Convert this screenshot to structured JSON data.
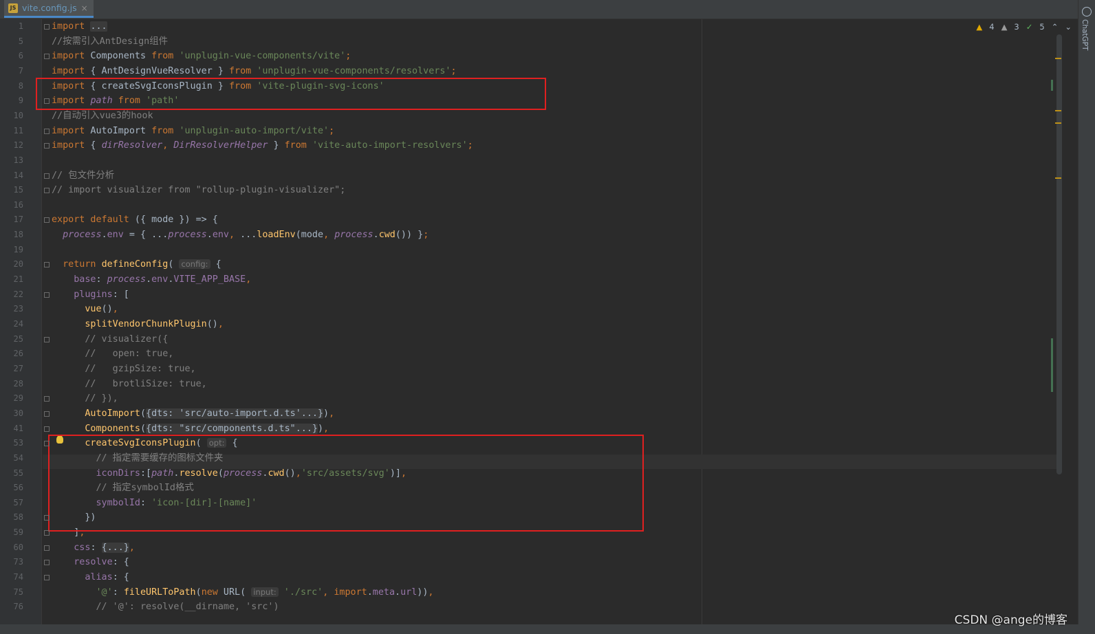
{
  "tab": {
    "label": "vite.config.js",
    "icon": "js-file-icon",
    "close": "×"
  },
  "right_panel": {
    "label": "ChatGPT",
    "icon": "openai-icon"
  },
  "inspection": {
    "warnings": "4",
    "weak_warnings": "3",
    "ok": "5",
    "prev": "^",
    "next": "v"
  },
  "line_numbers": [
    "1",
    "5",
    "6",
    "7",
    "8",
    "9",
    "10",
    "11",
    "12",
    "13",
    "14",
    "15",
    "16",
    "17",
    "18",
    "19",
    "20",
    "21",
    "22",
    "23",
    "24",
    "25",
    "26",
    "27",
    "28",
    "29",
    "30",
    "41",
    "53",
    "54",
    "55",
    "56",
    "57",
    "58",
    "59",
    "60",
    "73",
    "74",
    "75",
    "76"
  ],
  "code": [
    [
      {
        "c": "kw",
        "t": "import"
      },
      {
        "c": "",
        "t": " "
      },
      {
        "c": "fold-text",
        "t": "..."
      }
    ],
    [
      {
        "c": "cm",
        "t": "//按需引入AntDesign组件"
      }
    ],
    [
      {
        "c": "kw",
        "t": "import"
      },
      {
        "c": "",
        "t": " Components "
      },
      {
        "c": "kw",
        "t": "from"
      },
      {
        "c": "",
        "t": " "
      },
      {
        "c": "str",
        "t": "'unplugin-vue-components/vite'"
      },
      {
        "c": "kw",
        "t": ";"
      }
    ],
    [
      {
        "c": "kw",
        "t": "import"
      },
      {
        "c": "",
        "t": " { AntDesignVueResolver } "
      },
      {
        "c": "kw",
        "t": "from"
      },
      {
        "c": "",
        "t": " "
      },
      {
        "c": "str",
        "t": "'unplugin-vue-components/resolvers'"
      },
      {
        "c": "kw",
        "t": ";"
      }
    ],
    [
      {
        "c": "kw",
        "t": "import"
      },
      {
        "c": "",
        "t": " { createSvgIconsPlugin } "
      },
      {
        "c": "kw",
        "t": "from"
      },
      {
        "c": "",
        "t": " "
      },
      {
        "c": "str",
        "t": "'vite-plugin-svg-icons'"
      }
    ],
    [
      {
        "c": "kw",
        "t": "import"
      },
      {
        "c": "",
        "t": " "
      },
      {
        "c": "prop it",
        "t": "path"
      },
      {
        "c": "",
        "t": " "
      },
      {
        "c": "kw",
        "t": "from"
      },
      {
        "c": "",
        "t": " "
      },
      {
        "c": "str",
        "t": "'path'"
      }
    ],
    [
      {
        "c": "cm",
        "t": "//自动引入vue3的hook"
      }
    ],
    [
      {
        "c": "kw",
        "t": "import"
      },
      {
        "c": "",
        "t": " AutoImport "
      },
      {
        "c": "kw",
        "t": "from"
      },
      {
        "c": "",
        "t": " "
      },
      {
        "c": "str",
        "t": "'unplugin-auto-import/vite'"
      },
      {
        "c": "kw",
        "t": ";"
      }
    ],
    [
      {
        "c": "kw",
        "t": "import"
      },
      {
        "c": "",
        "t": " { "
      },
      {
        "c": "prop it",
        "t": "dirResolver"
      },
      {
        "c": "kw",
        "t": ","
      },
      {
        "c": "",
        "t": " "
      },
      {
        "c": "prop it",
        "t": "DirResolverHelper"
      },
      {
        "c": "",
        "t": " } "
      },
      {
        "c": "kw",
        "t": "from"
      },
      {
        "c": "",
        "t": " "
      },
      {
        "c": "str",
        "t": "'vite-auto-import-resolvers'"
      },
      {
        "c": "kw",
        "t": ";"
      }
    ],
    [],
    [
      {
        "c": "cm",
        "t": "// 包文件分析"
      }
    ],
    [
      {
        "c": "cm",
        "t": "// import visualizer from \"rollup-plugin-visualizer\";"
      }
    ],
    [],
    [
      {
        "c": "kw",
        "t": "export default"
      },
      {
        "c": "",
        "t": " ({ mode }) => {"
      }
    ],
    [
      {
        "c": "",
        "t": "  "
      },
      {
        "c": "prop it",
        "t": "process"
      },
      {
        "c": "",
        "t": "."
      },
      {
        "c": "prop",
        "t": "env"
      },
      {
        "c": "",
        "t": " = { ..."
      },
      {
        "c": "prop it",
        "t": "process"
      },
      {
        "c": "",
        "t": "."
      },
      {
        "c": "prop",
        "t": "env"
      },
      {
        "c": "kw",
        "t": ","
      },
      {
        "c": "",
        "t": " ..."
      },
      {
        "c": "fn",
        "t": "loadEnv"
      },
      {
        "c": "",
        "t": "(mode"
      },
      {
        "c": "kw",
        "t": ","
      },
      {
        "c": "",
        "t": " "
      },
      {
        "c": "prop it",
        "t": "process"
      },
      {
        "c": "",
        "t": "."
      },
      {
        "c": "fn",
        "t": "cwd"
      },
      {
        "c": "",
        "t": "()) }"
      },
      {
        "c": "kw",
        "t": ";"
      }
    ],
    [],
    [
      {
        "c": "",
        "t": "  "
      },
      {
        "c": "kw",
        "t": "return"
      },
      {
        "c": "",
        "t": " "
      },
      {
        "c": "fn",
        "t": "defineConfig"
      },
      {
        "c": "",
        "t": "( "
      },
      {
        "c": "hint",
        "t": "config:"
      },
      {
        "c": "",
        "t": " {"
      }
    ],
    [
      {
        "c": "",
        "t": "    "
      },
      {
        "c": "prop",
        "t": "base"
      },
      {
        "c": "",
        "t": ": "
      },
      {
        "c": "prop it",
        "t": "process"
      },
      {
        "c": "",
        "t": "."
      },
      {
        "c": "prop",
        "t": "env"
      },
      {
        "c": "",
        "t": "."
      },
      {
        "c": "prop",
        "t": "VITE_APP_BASE"
      },
      {
        "c": "kw",
        "t": ","
      }
    ],
    [
      {
        "c": "",
        "t": "    "
      },
      {
        "c": "prop",
        "t": "plugins"
      },
      {
        "c": "",
        "t": ": ["
      }
    ],
    [
      {
        "c": "",
        "t": "      "
      },
      {
        "c": "fn",
        "t": "vue"
      },
      {
        "c": "",
        "t": "()"
      },
      {
        "c": "kw",
        "t": ","
      }
    ],
    [
      {
        "c": "",
        "t": "      "
      },
      {
        "c": "fn",
        "t": "splitVendorChunkPlugin"
      },
      {
        "c": "",
        "t": "()"
      },
      {
        "c": "kw",
        "t": ","
      }
    ],
    [
      {
        "c": "",
        "t": "      "
      },
      {
        "c": "cm",
        "t": "// visualizer({"
      }
    ],
    [
      {
        "c": "",
        "t": "      "
      },
      {
        "c": "cm",
        "t": "//   open: true,"
      }
    ],
    [
      {
        "c": "",
        "t": "      "
      },
      {
        "c": "cm",
        "t": "//   gzipSize: true,"
      }
    ],
    [
      {
        "c": "",
        "t": "      "
      },
      {
        "c": "cm",
        "t": "//   brotliSize: true,"
      }
    ],
    [
      {
        "c": "",
        "t": "      "
      },
      {
        "c": "cm",
        "t": "// }),"
      }
    ],
    [
      {
        "c": "",
        "t": "      "
      },
      {
        "c": "fn",
        "t": "AutoImport"
      },
      {
        "c": "",
        "t": "("
      },
      {
        "c": "fold-text",
        "t": "{dts: 'src/auto-import.d.ts'...}"
      },
      {
        "c": "",
        "t": ")"
      },
      {
        "c": "kw",
        "t": ","
      }
    ],
    [
      {
        "c": "",
        "t": "      "
      },
      {
        "c": "fn",
        "t": "Components"
      },
      {
        "c": "",
        "t": "("
      },
      {
        "c": "fold-text",
        "t": "{dts: \"src/components.d.ts\"...}"
      },
      {
        "c": "",
        "t": ")"
      },
      {
        "c": "kw",
        "t": ","
      }
    ],
    [
      {
        "c": "",
        "t": "      "
      },
      {
        "c": "fn",
        "t": "createSvgIconsPlugin"
      },
      {
        "c": "",
        "t": "( "
      },
      {
        "c": "hint",
        "t": "opt:"
      },
      {
        "c": "",
        "t": " {"
      }
    ],
    [
      {
        "c": "",
        "t": "        "
      },
      {
        "c": "cm",
        "t": "// 指定需要缓存的图标文件夹"
      }
    ],
    [
      {
        "c": "",
        "t": "        "
      },
      {
        "c": "prop",
        "t": "iconDirs"
      },
      {
        "c": "",
        "t": ":["
      },
      {
        "c": "prop it",
        "t": "path"
      },
      {
        "c": "",
        "t": "."
      },
      {
        "c": "fn",
        "t": "resolve"
      },
      {
        "c": "",
        "t": "("
      },
      {
        "c": "prop it",
        "t": "process"
      },
      {
        "c": "",
        "t": "."
      },
      {
        "c": "fn",
        "t": "cwd"
      },
      {
        "c": "",
        "t": "()"
      },
      {
        "c": "kw",
        "t": ","
      },
      {
        "c": "str",
        "t": "'src/assets/svg'"
      },
      {
        "c": "",
        "t": ")]"
      },
      {
        "c": "kw",
        "t": ","
      }
    ],
    [
      {
        "c": "",
        "t": "        "
      },
      {
        "c": "cm",
        "t": "// 指定symbolId格式"
      }
    ],
    [
      {
        "c": "",
        "t": "        "
      },
      {
        "c": "prop",
        "t": "symbolId"
      },
      {
        "c": "",
        "t": ": "
      },
      {
        "c": "str",
        "t": "'icon-[dir]-[name]'"
      }
    ],
    [
      {
        "c": "",
        "t": "      })"
      }
    ],
    [
      {
        "c": "",
        "t": "    ]"
      },
      {
        "c": "kw",
        "t": ","
      }
    ],
    [
      {
        "c": "",
        "t": "    "
      },
      {
        "c": "prop",
        "t": "css"
      },
      {
        "c": "",
        "t": ": "
      },
      {
        "c": "fold-text",
        "t": "{...}"
      },
      {
        "c": "kw",
        "t": ","
      }
    ],
    [
      {
        "c": "",
        "t": "    "
      },
      {
        "c": "prop",
        "t": "resolve"
      },
      {
        "c": "",
        "t": ": {"
      }
    ],
    [
      {
        "c": "",
        "t": "      "
      },
      {
        "c": "prop",
        "t": "alias"
      },
      {
        "c": "",
        "t": ": {"
      }
    ],
    [
      {
        "c": "",
        "t": "        "
      },
      {
        "c": "str",
        "t": "'@'"
      },
      {
        "c": "",
        "t": ": "
      },
      {
        "c": "fn",
        "t": "fileURLToPath"
      },
      {
        "c": "",
        "t": "("
      },
      {
        "c": "kw",
        "t": "new"
      },
      {
        "c": "",
        "t": " URL( "
      },
      {
        "c": "hint",
        "t": "input:"
      },
      {
        "c": "",
        "t": " "
      },
      {
        "c": "str",
        "t": "'./src'"
      },
      {
        "c": "kw",
        "t": ","
      },
      {
        "c": "",
        "t": " "
      },
      {
        "c": "kw",
        "t": "import"
      },
      {
        "c": "",
        "t": "."
      },
      {
        "c": "prop",
        "t": "meta"
      },
      {
        "c": "",
        "t": "."
      },
      {
        "c": "prop",
        "t": "url"
      },
      {
        "c": "",
        "t": "))"
      },
      {
        "c": "kw",
        "t": ","
      }
    ],
    [
      {
        "c": "",
        "t": "        "
      },
      {
        "c": "cm",
        "t": "// '@': resolve(__dirname, 'src')"
      }
    ]
  ],
  "watermark": "CSDN @ange的博客"
}
